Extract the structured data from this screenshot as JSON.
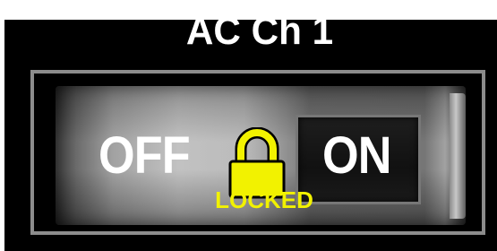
{
  "title": "AC Ch 1",
  "switch": {
    "off_label": "OFF",
    "on_label": "ON",
    "state": "on",
    "lock_label": "LOCKED",
    "locked": true
  },
  "icons": {
    "lock": "lock-icon"
  },
  "colors": {
    "background": "#000000",
    "text": "#ffffff",
    "lock": "#f2f200",
    "frame": "#8c8c8c"
  }
}
